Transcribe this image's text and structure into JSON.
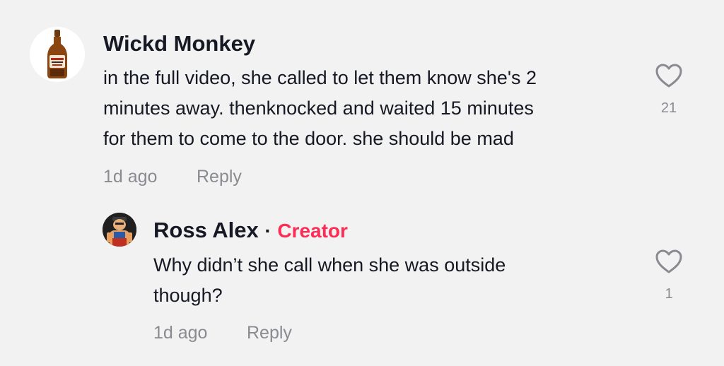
{
  "comments": [
    {
      "author": "Wickd Monkey",
      "text_lines": [
        "in the full video, she called to let them know she's 2",
        "minutes away. thenknocked and waited 15 minutes",
        "for them to come to the door. she should be mad"
      ],
      "time": "1d ago",
      "reply_label": "Reply",
      "likes": "21",
      "avatar_icon": "sauce-bottle-icon"
    },
    {
      "author": "Ross Alex",
      "separator": "·",
      "badge": "Creator",
      "text_lines": [
        "Why didn’t she call when she was outside",
        "though?"
      ],
      "time": "1d ago",
      "reply_label": "Reply",
      "likes": "1",
      "avatar_icon": "cartoon-avatar-icon"
    }
  ],
  "colors": {
    "background": "#f2f2f2",
    "creator_badge": "#fe2c55",
    "secondary_text": "#8a8b91",
    "primary_text": "#161823"
  }
}
